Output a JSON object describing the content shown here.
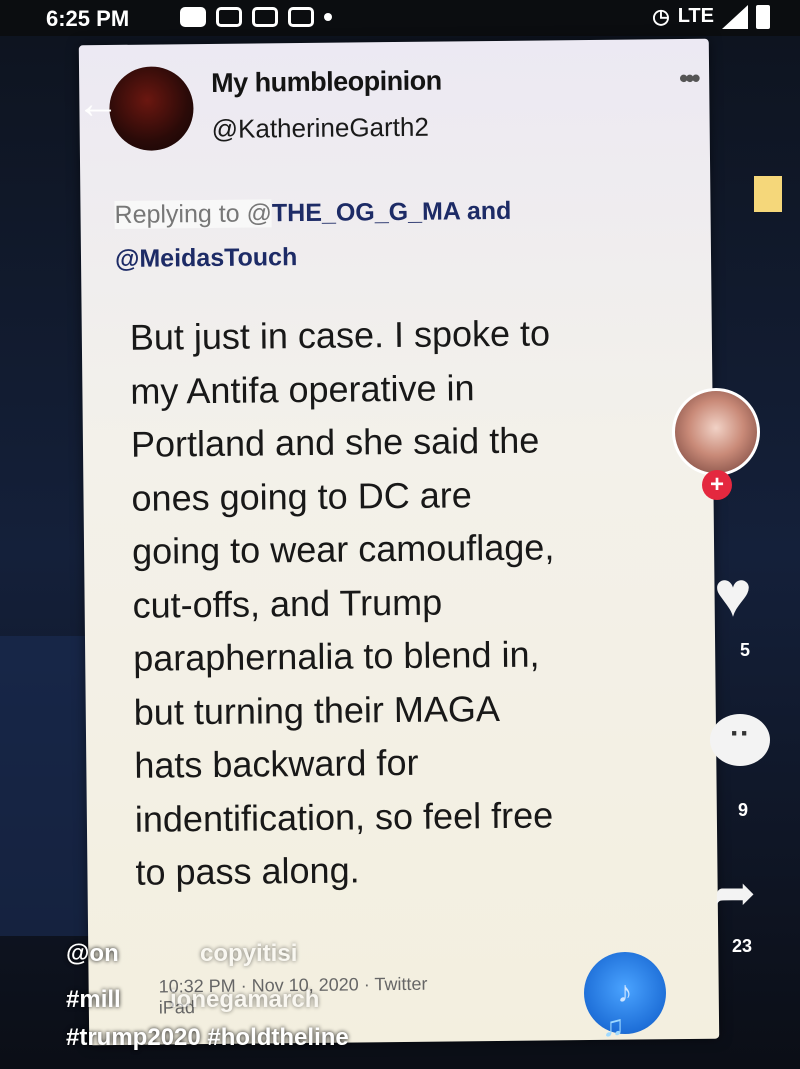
{
  "status_bar": {
    "time": "6:25 PM",
    "network": "LTE"
  },
  "tweet": {
    "display_name": "My humbleopinion",
    "handle": "@KatherineGarth2",
    "more_label": "•••",
    "reply_prefix": "Replying to @",
    "reply_to_1": "THE_OG_G_MA and",
    "reply_to_2": "@MeidasTouch",
    "body_lines": [
      "But just in case. I spoke to",
      "my Antifa operative in",
      "Portland and she said the",
      "ones going to DC  are",
      "going to wear camouflage,",
      "cut-offs, and Trump",
      "paraphernalia to blend in,",
      "but turning their MAGA",
      "hats backward for",
      "indentification, so feel free",
      "to pass along."
    ],
    "timestamp": "10:32 PM · Nov 10, 2020 · Twitter",
    "source": "iPad"
  },
  "overlay": {
    "back_icon": "back-arrow-icon",
    "like_count": "5",
    "comment_count": "9",
    "share_count": "23",
    "caption_user": "@on",
    "caption_line2": "#mill",
    "caption_line3": "#trump2020 #holdtheline",
    "faded_1": "copyitisi",
    "faded_2": "ionegamarch"
  },
  "colors": {
    "reply_link": "#1d2b66",
    "plus_badge": "#e4283f",
    "music_disc": "#1e6fd8"
  }
}
